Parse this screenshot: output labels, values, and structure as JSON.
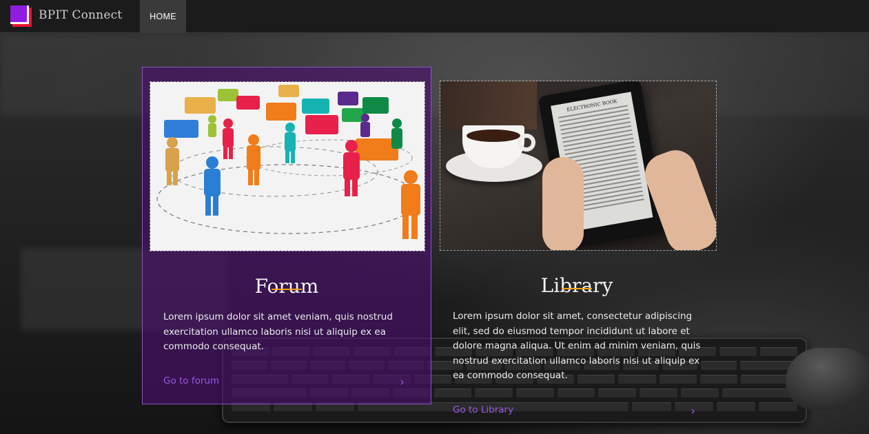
{
  "header": {
    "brand": "BPIT Connect",
    "nav": [
      {
        "label": "HOME",
        "active": true
      }
    ]
  },
  "cards": [
    {
      "title": "Forum",
      "text": "Lorem ipsum dolor sit amet veniam, quis nostrud exercitation ullamco laboris nisi ut aliquip ex ea commodo consequat.",
      "link": "Go to forum",
      "arrow": "›"
    },
    {
      "title": "Library",
      "text": "Lorem ipsum dolor sit amet, consectetur adipiscing elit, sed do eiusmod tempor incididunt ut labore et dolore magna aliqua. Ut enim ad minim veniam, quis nostrud exercitation ullamco laboris nisi ut aliquip ex ea commodo consequat.",
      "link": "Go to Library",
      "arrow": "›",
      "image_text": "ELECTRONIC BOOK"
    }
  ],
  "colors": {
    "accent": "#9b57e6",
    "underline": "#f0a21c",
    "forum_card": "#4b0f6e"
  },
  "icons": {
    "logo": "bpit-logo-icon",
    "arrow": "chevron-right-icon"
  }
}
